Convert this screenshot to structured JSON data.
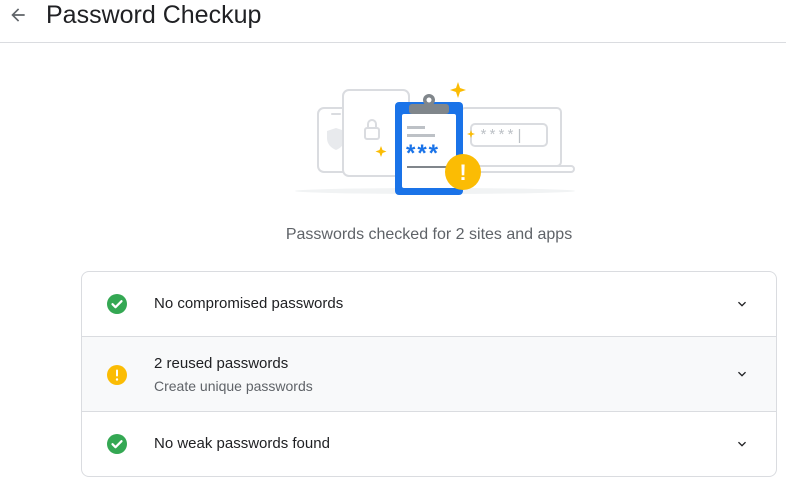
{
  "header": {
    "title": "Password Checkup",
    "back_icon": "arrow-back-icon"
  },
  "illustration": {
    "clipboard_text": "***",
    "field_text": "****|",
    "warning_mark": "!"
  },
  "summary": {
    "text": "Passwords checked for 2 sites and apps"
  },
  "results": [
    {
      "title": "No compromised passwords",
      "subtitle": "",
      "status": "ok",
      "icon": "check-circle-icon",
      "color": "#34a853"
    },
    {
      "title": "2 reused passwords",
      "subtitle": "Create unique passwords",
      "status": "warning",
      "icon": "warning-circle-icon",
      "color": "#fbbc04"
    },
    {
      "title": "No weak passwords found",
      "subtitle": "",
      "status": "ok",
      "icon": "check-circle-icon",
      "color": "#34a853"
    }
  ],
  "colors": {
    "accent_blue": "#1a73e8",
    "ok_green": "#34a853",
    "warn_yellow": "#fbbc04",
    "divider": "#dadce0"
  }
}
